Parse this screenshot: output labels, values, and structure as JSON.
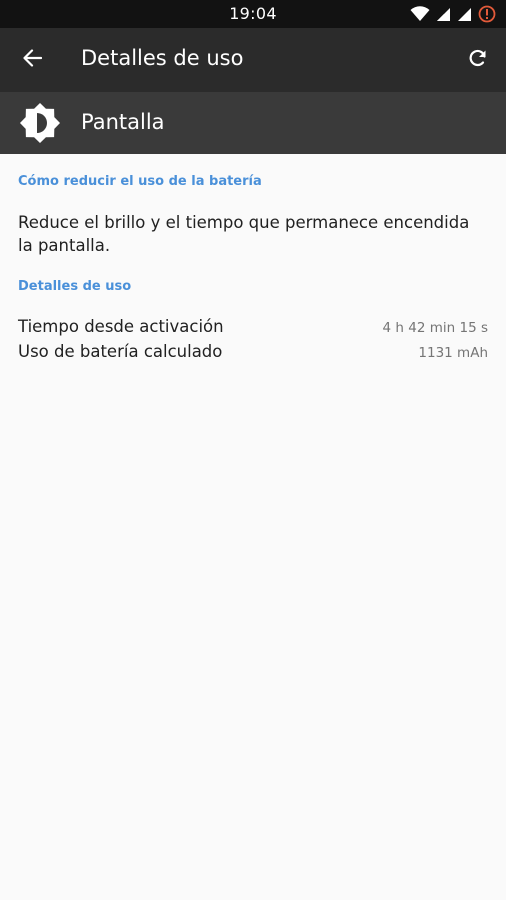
{
  "status_bar": {
    "time": "19:04",
    "icons": [
      "wifi-icon",
      "signal-icon",
      "signal-icon",
      "alert-icon"
    ]
  },
  "app_bar": {
    "title": "Detalles de uso",
    "back_icon": "arrow-left-icon",
    "refresh_icon": "refresh-icon"
  },
  "header": {
    "icon": "brightness-icon",
    "name": "Pantalla"
  },
  "sections": {
    "reduce": {
      "header": "Cómo reducir el uso de la batería",
      "tip": "Reduce el brillo y el tiempo que permanece encendida la pantalla."
    },
    "usage": {
      "header": "Detalles de uso",
      "rows": [
        {
          "label": "Tiempo desde activación",
          "value": "4 h 42 min 15 s"
        },
        {
          "label": "Uso de batería calculado",
          "value": "1131 mAh"
        }
      ]
    }
  },
  "colors": {
    "accent": "#4a90d9",
    "app_bar": "#2b2b2b",
    "header_row": "#3a3a3a",
    "status_bar": "#121212",
    "alert": "#e25a3a"
  }
}
